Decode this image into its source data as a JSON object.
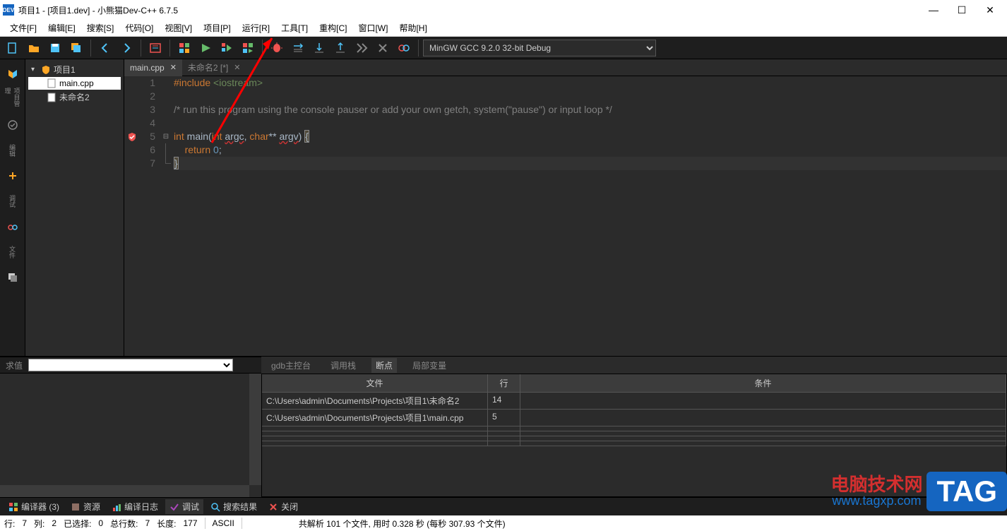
{
  "window": {
    "title": "项目1 - [项目1.dev] - 小熊猫Dev-C++ 6.7.5"
  },
  "menu": {
    "file": "文件[F]",
    "edit": "编辑[E]",
    "search": "搜索[S]",
    "code": "代码[O]",
    "view": "视图[V]",
    "project": "项目[P]",
    "run": "运行[R]",
    "tools": "工具[T]",
    "refactor": "重构[C]",
    "window": "窗口[W]",
    "help": "帮助[H]"
  },
  "compiler_select": "MinGW GCC 9.2.0 32-bit Debug",
  "sidebar_tabs": {
    "project_mgr": "项目管理",
    "edit": "编辑",
    "debug": "调试",
    "files": "文件"
  },
  "project_tree": {
    "root": "项目1",
    "file1": "main.cpp",
    "file2": "未命名2"
  },
  "editor_tabs": {
    "tab1": "main.cpp",
    "tab2": "未命名2 [*]"
  },
  "code": {
    "l1": "#include <iostream>",
    "l2": "",
    "l3": "/* run this program using the console pauser or add your own getch, system(\"pause\") or input loop */",
    "l4": "",
    "l5a": "int",
    "l5b": " main(",
    "l5c": "int",
    "l5d": " argc",
    "l5e": ", ",
    "l5f": "char",
    "l5g": "** argv",
    "l5h": ") ",
    "l5i": "{",
    "l6": "    return 0;",
    "l7": "}"
  },
  "line_nums": {
    "1": "1",
    "2": "2",
    "3": "3",
    "4": "4",
    "5": "5",
    "6": "6",
    "7": "7"
  },
  "eval_label": "求值",
  "debug_panel_tabs": {
    "console": "gdb主控台",
    "callstack": "调用栈",
    "breakpoints": "断点",
    "locals": "局部变量"
  },
  "bp_headers": {
    "file": "文件",
    "line": "行",
    "cond": "条件"
  },
  "breakpoints": [
    {
      "file": "C:\\Users\\admin\\Documents\\Projects\\项目1\\未命名2",
      "line": "14"
    },
    {
      "file": "C:\\Users\\admin\\Documents\\Projects\\项目1\\main.cpp",
      "line": "5"
    }
  ],
  "bottom_tabs": {
    "compiler": "编译器 (3)",
    "resource": "资源",
    "log": "编译日志",
    "debug": "调试",
    "search": "搜索结果",
    "close": "关闭"
  },
  "status": {
    "row": "行:",
    "row_v": "7",
    "col": "列:",
    "col_v": "2",
    "sel": "已选择:",
    "sel_v": "0",
    "total": "总行数:",
    "total_v": "7",
    "len": "长度:",
    "len_v": "177",
    "enc": "ASCII",
    "parse": "共解析 101 个文件, 用时 0.328 秒 (每秒 307.93 个文件)"
  },
  "watermark": {
    "brand": "电脑技术网",
    "url": "www.tagxp.com",
    "tag": "TAG"
  }
}
